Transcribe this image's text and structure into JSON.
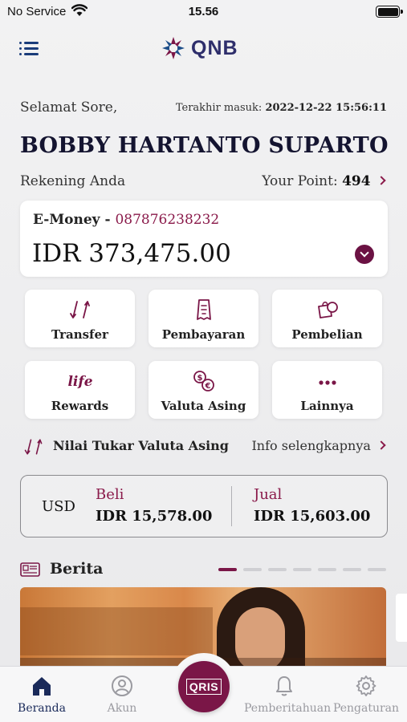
{
  "status_bar": {
    "carrier": "No Service",
    "time": "15.56"
  },
  "header": {
    "logo_text": "QNB"
  },
  "greeting": {
    "salutation": "Selamat Sore,",
    "last_login_label": "Terakhir masuk:",
    "last_login_value": "2022-12-22 15:56:11",
    "name": "BOBBY HARTANTO SUPARTO"
  },
  "accounts": {
    "label": "Rekening Anda",
    "points_label": "Your Point:",
    "points_value": "494",
    "card": {
      "type": "E-Money - ",
      "number": "087876238232",
      "balance": "IDR 373,475.00"
    }
  },
  "menu": {
    "items": [
      {
        "label": "Transfer",
        "icon": "transfer-arrows-icon"
      },
      {
        "label": "Pembayaran",
        "icon": "receipt-icon"
      },
      {
        "label": "Pembelian",
        "icon": "shopping-bag-icon"
      },
      {
        "label": "Rewards",
        "icon": "life-rewards-icon"
      },
      {
        "label": "Valuta Asing",
        "icon": "currency-exchange-icon"
      },
      {
        "label": "Lainnya",
        "icon": "more-dots-icon"
      }
    ]
  },
  "exchange": {
    "title": "Nilai Tukar Valuta Asing",
    "more_link": "Info selengkapnya",
    "currency": "USD",
    "buy_label": "Beli",
    "buy_value": "IDR 15,578.00",
    "sell_label": "Jual",
    "sell_value": "IDR 15,603.00"
  },
  "news": {
    "title": "Berita",
    "page_count": 7,
    "active_page": 1
  },
  "tabbar": {
    "items": [
      {
        "label": "Beranda",
        "icon": "home-icon",
        "active": true
      },
      {
        "label": "Akun",
        "icon": "account-icon",
        "active": false
      },
      {
        "label": "Pemberitahuan",
        "icon": "bell-icon",
        "active": false
      },
      {
        "label": "Pengaturan",
        "icon": "gear-icon",
        "active": false
      }
    ],
    "qris_label": "QRIS"
  },
  "colors": {
    "brand_maroon": "#7a1647",
    "brand_navy": "#1a2a5a",
    "accent_text": "#8a1a4a"
  }
}
